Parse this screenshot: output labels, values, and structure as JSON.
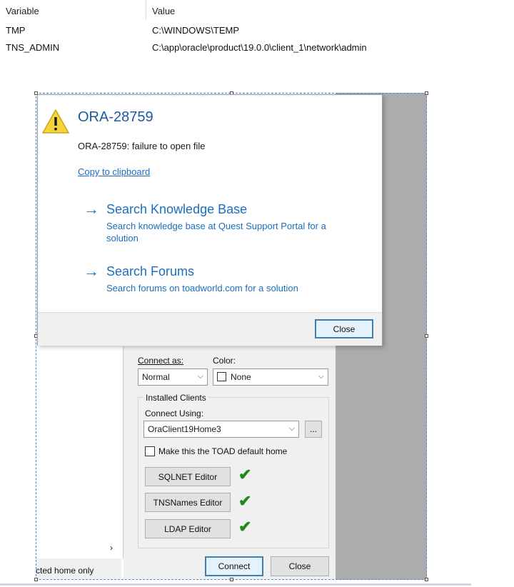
{
  "env_table": {
    "headers": {
      "variable": "Variable",
      "value": "Value"
    },
    "rows": [
      {
        "variable": "TMP",
        "value": "C:\\WINDOWS\\TEMP"
      },
      {
        "variable": "TNS_ADMIN",
        "value": "C:\\app\\oracle\\product\\19.0.0\\client_1\\network\\admin"
      }
    ]
  },
  "error_dialog": {
    "icon": "warning-icon",
    "title": "ORA-28759",
    "message": "ORA-28759: failure to open file",
    "copy_link": "Copy to clipboard",
    "kb": {
      "title": "Search Knowledge Base",
      "line1": "Search knowledge base at Quest Support Portal for a",
      "line2": "solution"
    },
    "forums": {
      "title": "Search Forums",
      "subtitle": "Search forums on toadworld.com for a solution"
    },
    "close_label": "Close"
  },
  "connection": {
    "connect_as_label": "Connect as:",
    "connect_as_value": "Normal",
    "color_label": "Color:",
    "color_value": "None",
    "installed_clients_label": "Installed Clients",
    "connect_using_label": "Connect Using:",
    "connect_using_value": "OraClient19Home3",
    "browse_label": "...",
    "default_home_label": "Make this the TOAD default home",
    "sqlnet_label": "SQLNET Editor",
    "tnsnames_label": "TNSNames Editor",
    "ldap_label": "LDAP Editor",
    "status_text": "cted home only",
    "connect_label": "Connect",
    "close_label": "Close",
    "scroll_right": "›"
  }
}
